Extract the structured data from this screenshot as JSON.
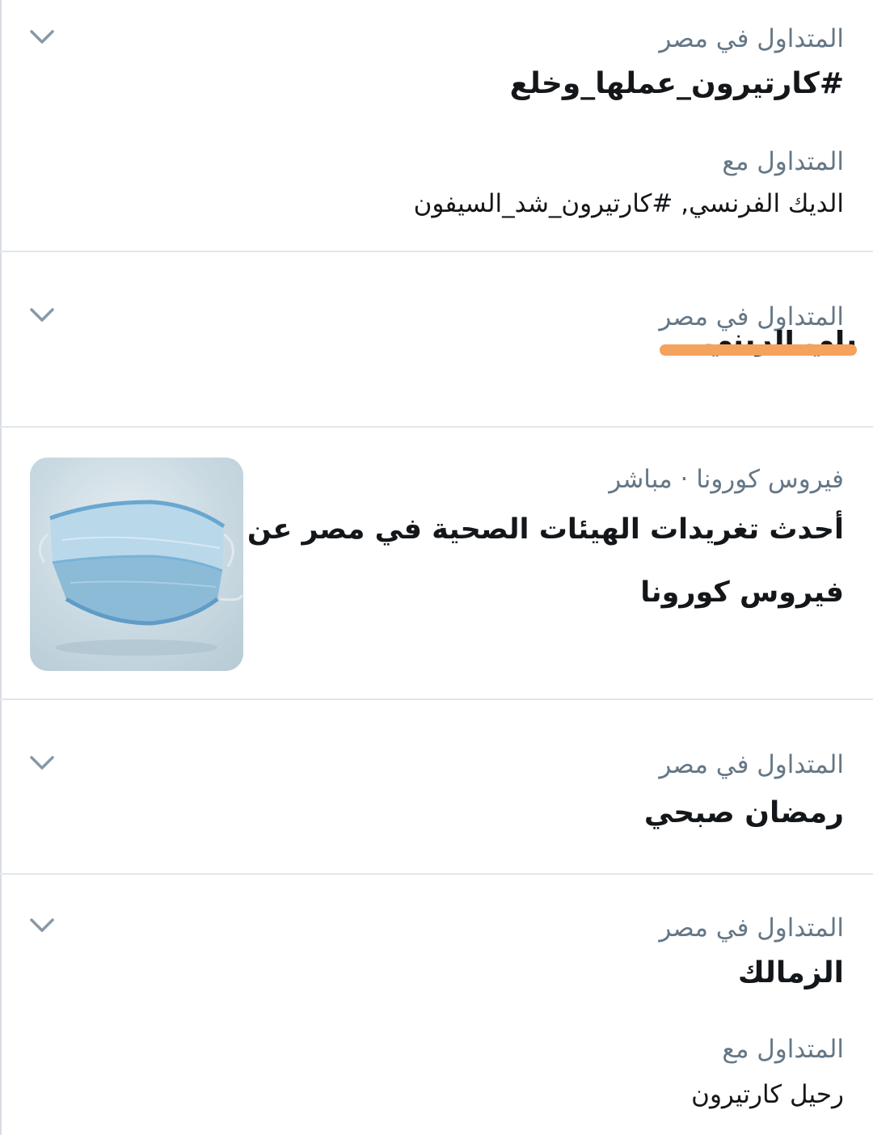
{
  "colors": {
    "label": "#657786",
    "title": "#14171a",
    "divider": "#e1e6ea",
    "chevron": "#8899a6",
    "redaction": "#f4a25c"
  },
  "trends": [
    {
      "context": "المتداول في مصر",
      "title": "#كارتيرون_عملها_وخلع",
      "related_label": "المتداول مع",
      "related": "الديك الفرنسي, #كارتيرون_شد_السيفون",
      "menu_icon": "chevron-down-icon"
    },
    {
      "context": "المتداول في مصر",
      "title_redacted": true,
      "menu_icon": "chevron-down-icon"
    },
    {
      "context": "فيروس كورونا · مباشر",
      "title_line1": "أحدث تغريدات الهيئات الصحية في مصر عن",
      "title_line2": "فيروس كورونا",
      "thumbnail": "face-mask-image"
    },
    {
      "context": "المتداول في مصر",
      "title": "رمضان صبحي",
      "menu_icon": "chevron-down-icon"
    },
    {
      "context": "المتداول في مصر",
      "title": "الزمالك",
      "related_label": "المتداول مع",
      "related": "رحيل كارتيرون",
      "menu_icon": "chevron-down-icon"
    }
  ]
}
